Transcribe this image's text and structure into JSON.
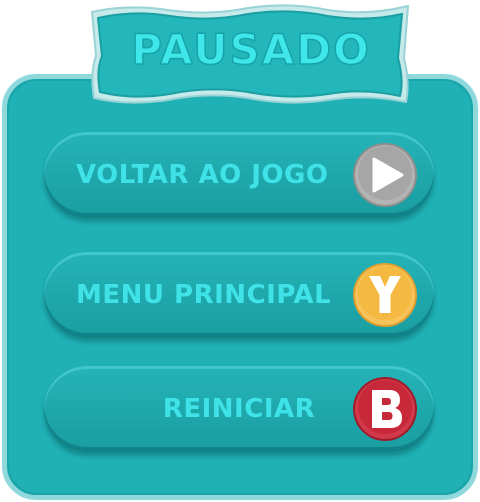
{
  "title": "PAUSADO",
  "menu": {
    "items": [
      {
        "label": "VOLTAR AO JOGO",
        "button_glyph": "play-icon",
        "button_color": "#a8a8a8"
      },
      {
        "label": "MENU PRINCIPAL",
        "button_glyph": "Y",
        "button_color": "#f5b840"
      },
      {
        "label": "REINICIAR",
        "button_glyph": "B",
        "button_color": "#c7283a"
      }
    ]
  },
  "colors": {
    "panel": "#1fb1b5",
    "panel_border": "#8fd9dc",
    "text": "#3fe3e7",
    "banner_fill": "#23b6ba"
  }
}
